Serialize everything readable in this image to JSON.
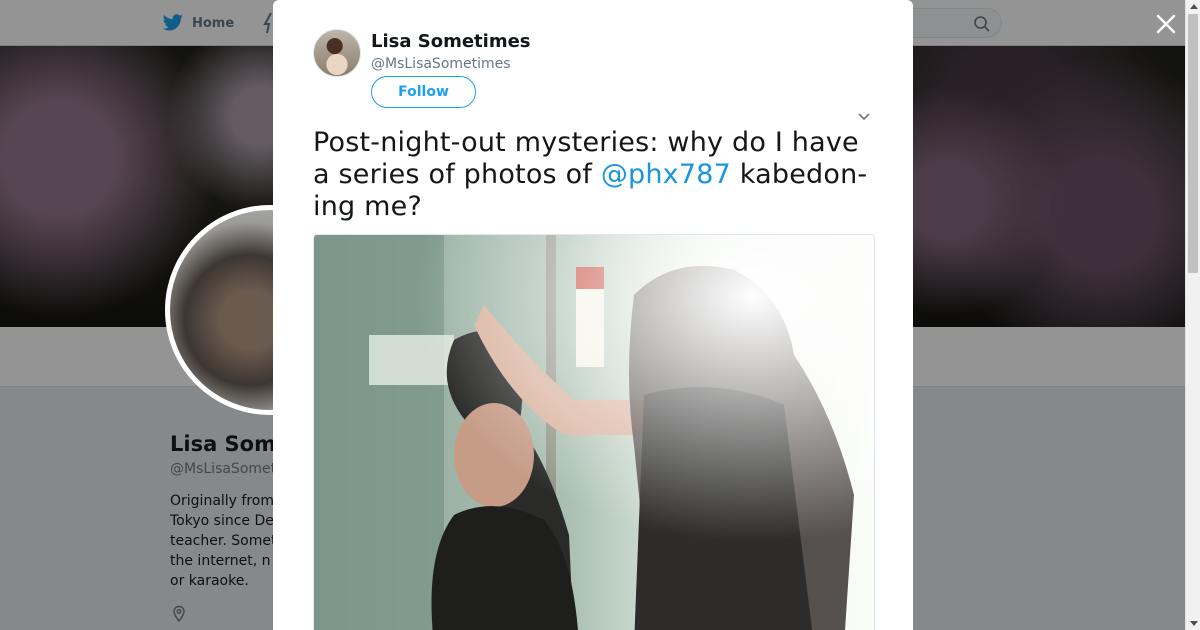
{
  "nav": {
    "home_label": "Home"
  },
  "profile_bg": {
    "name": "Lisa Som",
    "handle": "@MsLisaSomet",
    "bio": "Originally from\nTokyo since De\nteacher. Somet\nthe internet, n\nor karaoke."
  },
  "tweet": {
    "author_name": "Lisa Sometimes",
    "author_handle": "@MsLisaSometimes",
    "follow_label": "Follow",
    "text_before": "Post-night-out mysteries: why do I have a series of photos of ",
    "mention": "@phx787",
    "text_after": " kabedon-ing me?"
  },
  "colors": {
    "twitter_blue": "#1da1f2",
    "mention_blue": "#1b95e0"
  },
  "icons": {
    "close": "close-icon",
    "twitter": "twitter-bird-icon",
    "search": "search-icon",
    "caret": "chevron-down-icon",
    "location": "location-pin-icon"
  }
}
